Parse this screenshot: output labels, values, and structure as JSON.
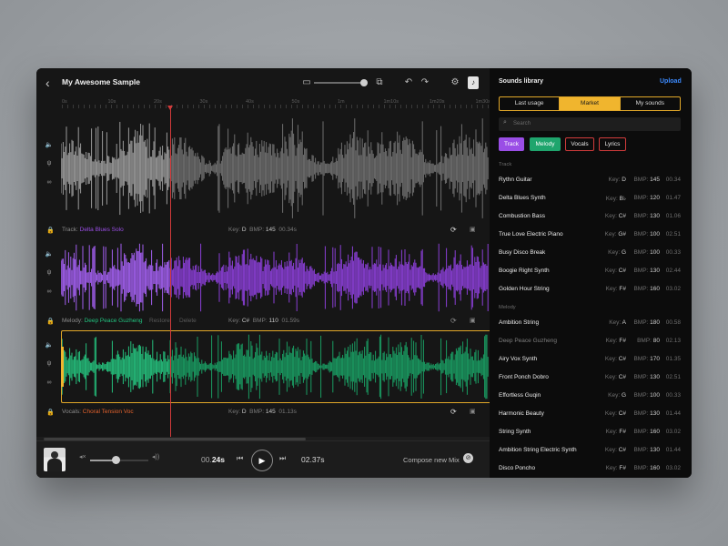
{
  "header": {
    "title": "My Awesome Sample"
  },
  "ruler": [
    {
      "label": "0s",
      "pos": 0
    },
    {
      "label": "10s",
      "pos": 1
    },
    {
      "label": "20s",
      "pos": 2
    },
    {
      "label": "30s",
      "pos": 3
    },
    {
      "label": "40s",
      "pos": 4
    },
    {
      "label": "50s",
      "pos": 5
    },
    {
      "label": "1m",
      "pos": 6
    },
    {
      "label": "1m10s",
      "pos": 7
    },
    {
      "label": "1m20s",
      "pos": 8
    },
    {
      "label": "1m30s",
      "pos": 9
    }
  ],
  "tracks": [
    {
      "kind_label": "Track: ",
      "name": "Delta Blues Solo",
      "key_label": "Key:",
      "key": "D",
      "bmp_label": "BMP:",
      "bmp": "145",
      "duration": "00.34s",
      "kind_color": "#9a4ee6",
      "restore": "",
      "delete": ""
    },
    {
      "kind_label": "Melody: ",
      "name": "Deep Peace Guzheng",
      "key_label": "Key:",
      "key": "C#",
      "bmp_label": "BMP:",
      "bmp": "110",
      "duration": "01.59s",
      "kind_color": "#22c27f",
      "restore": "Restore",
      "delete": "Delete"
    },
    {
      "kind_label": "Vocals: ",
      "name": "Choral Tension Voc",
      "key_label": "Key:",
      "key": "D",
      "bmp_label": "BMP:",
      "bmp": "145",
      "duration": "01.13s",
      "kind_color": "#e2622d",
      "restore": "",
      "delete": ""
    }
  ],
  "player": {
    "current_prefix": "00.",
    "current_strong": "24s",
    "total": "02.37s",
    "compose_label": "Compose new Mix",
    "volume_level": 0.42
  },
  "library": {
    "title": "Sounds library",
    "upload_label": "Upload",
    "tabs": [
      {
        "label": "Last usage",
        "active": false
      },
      {
        "label": "Market",
        "active": true
      },
      {
        "label": "My sounds",
        "active": false
      }
    ],
    "search_placeholder": "Search",
    "filters": [
      "Track",
      "Melody",
      "Vocals",
      "Lyrics"
    ],
    "sections": [
      {
        "label": "Track",
        "items": [
          {
            "name": "Rythn Guitar",
            "key": "D",
            "bmp": "145",
            "duration": "00.34",
            "dim": false
          },
          {
            "name": "Delta Blues Synth",
            "key": "B♭",
            "bmp": "120",
            "duration": "01.47",
            "dim": false
          },
          {
            "name": "Combustion Bass",
            "key": "C#",
            "bmp": "130",
            "duration": "01.06",
            "dim": false
          },
          {
            "name": "True Love Electric Piano",
            "key": "G#",
            "bmp": "100",
            "duration": "02.51",
            "dim": false
          },
          {
            "name": "Busy Disco Break",
            "key": "G",
            "bmp": "100",
            "duration": "00.33",
            "dim": false
          },
          {
            "name": "Boogie Right Synth",
            "key": "C#",
            "bmp": "130",
            "duration": "02.44",
            "dim": false
          },
          {
            "name": "Golden Hour String",
            "key": "F#",
            "bmp": "160",
            "duration": "03.02",
            "dim": false
          }
        ]
      },
      {
        "label": "Melody",
        "items": [
          {
            "name": "Ambition String",
            "key": "A",
            "bmp": "180",
            "duration": "00.58",
            "dim": false
          },
          {
            "name": "Deep Peace Guzheng",
            "key": "F#",
            "bmp": "80",
            "duration": "02.13",
            "dim": true
          },
          {
            "name": "Airy Vox Synth",
            "key": "C#",
            "bmp": "170",
            "duration": "01.35",
            "dim": false
          },
          {
            "name": "Front Ponch Dobro",
            "key": "C#",
            "bmp": "130",
            "duration": "02.51",
            "dim": false
          },
          {
            "name": "Effortless Guqin",
            "key": "G",
            "bmp": "100",
            "duration": "00.33",
            "dim": false
          },
          {
            "name": "Harmonic Beauty",
            "key": "C#",
            "bmp": "130",
            "duration": "01.44",
            "dim": false
          },
          {
            "name": "String Synth",
            "key": "F#",
            "bmp": "160",
            "duration": "03.02",
            "dim": false
          },
          {
            "name": "Ambition String Electric Synth",
            "key": "C#",
            "bmp": "130",
            "duration": "01.44",
            "dim": false
          },
          {
            "name": "Disco Poncho",
            "key": "F#",
            "bmp": "160",
            "duration": "03.02",
            "dim": false
          }
        ]
      }
    ],
    "key_label": "Key:",
    "bmp_label": "BMP:"
  },
  "colors": {
    "accent": "#f0b52e",
    "upload": "#3d8bff",
    "track": "#9a4ee6",
    "melody": "#1fa56d",
    "vocals": "#d23c3c",
    "playhead": "#d13a3a"
  },
  "icons": {
    "back": "back-arrow-icon",
    "undo": "undo-icon",
    "redo": "redo-icon",
    "settings": "gear-icon",
    "search": "search-icon",
    "play": "play-icon"
  }
}
